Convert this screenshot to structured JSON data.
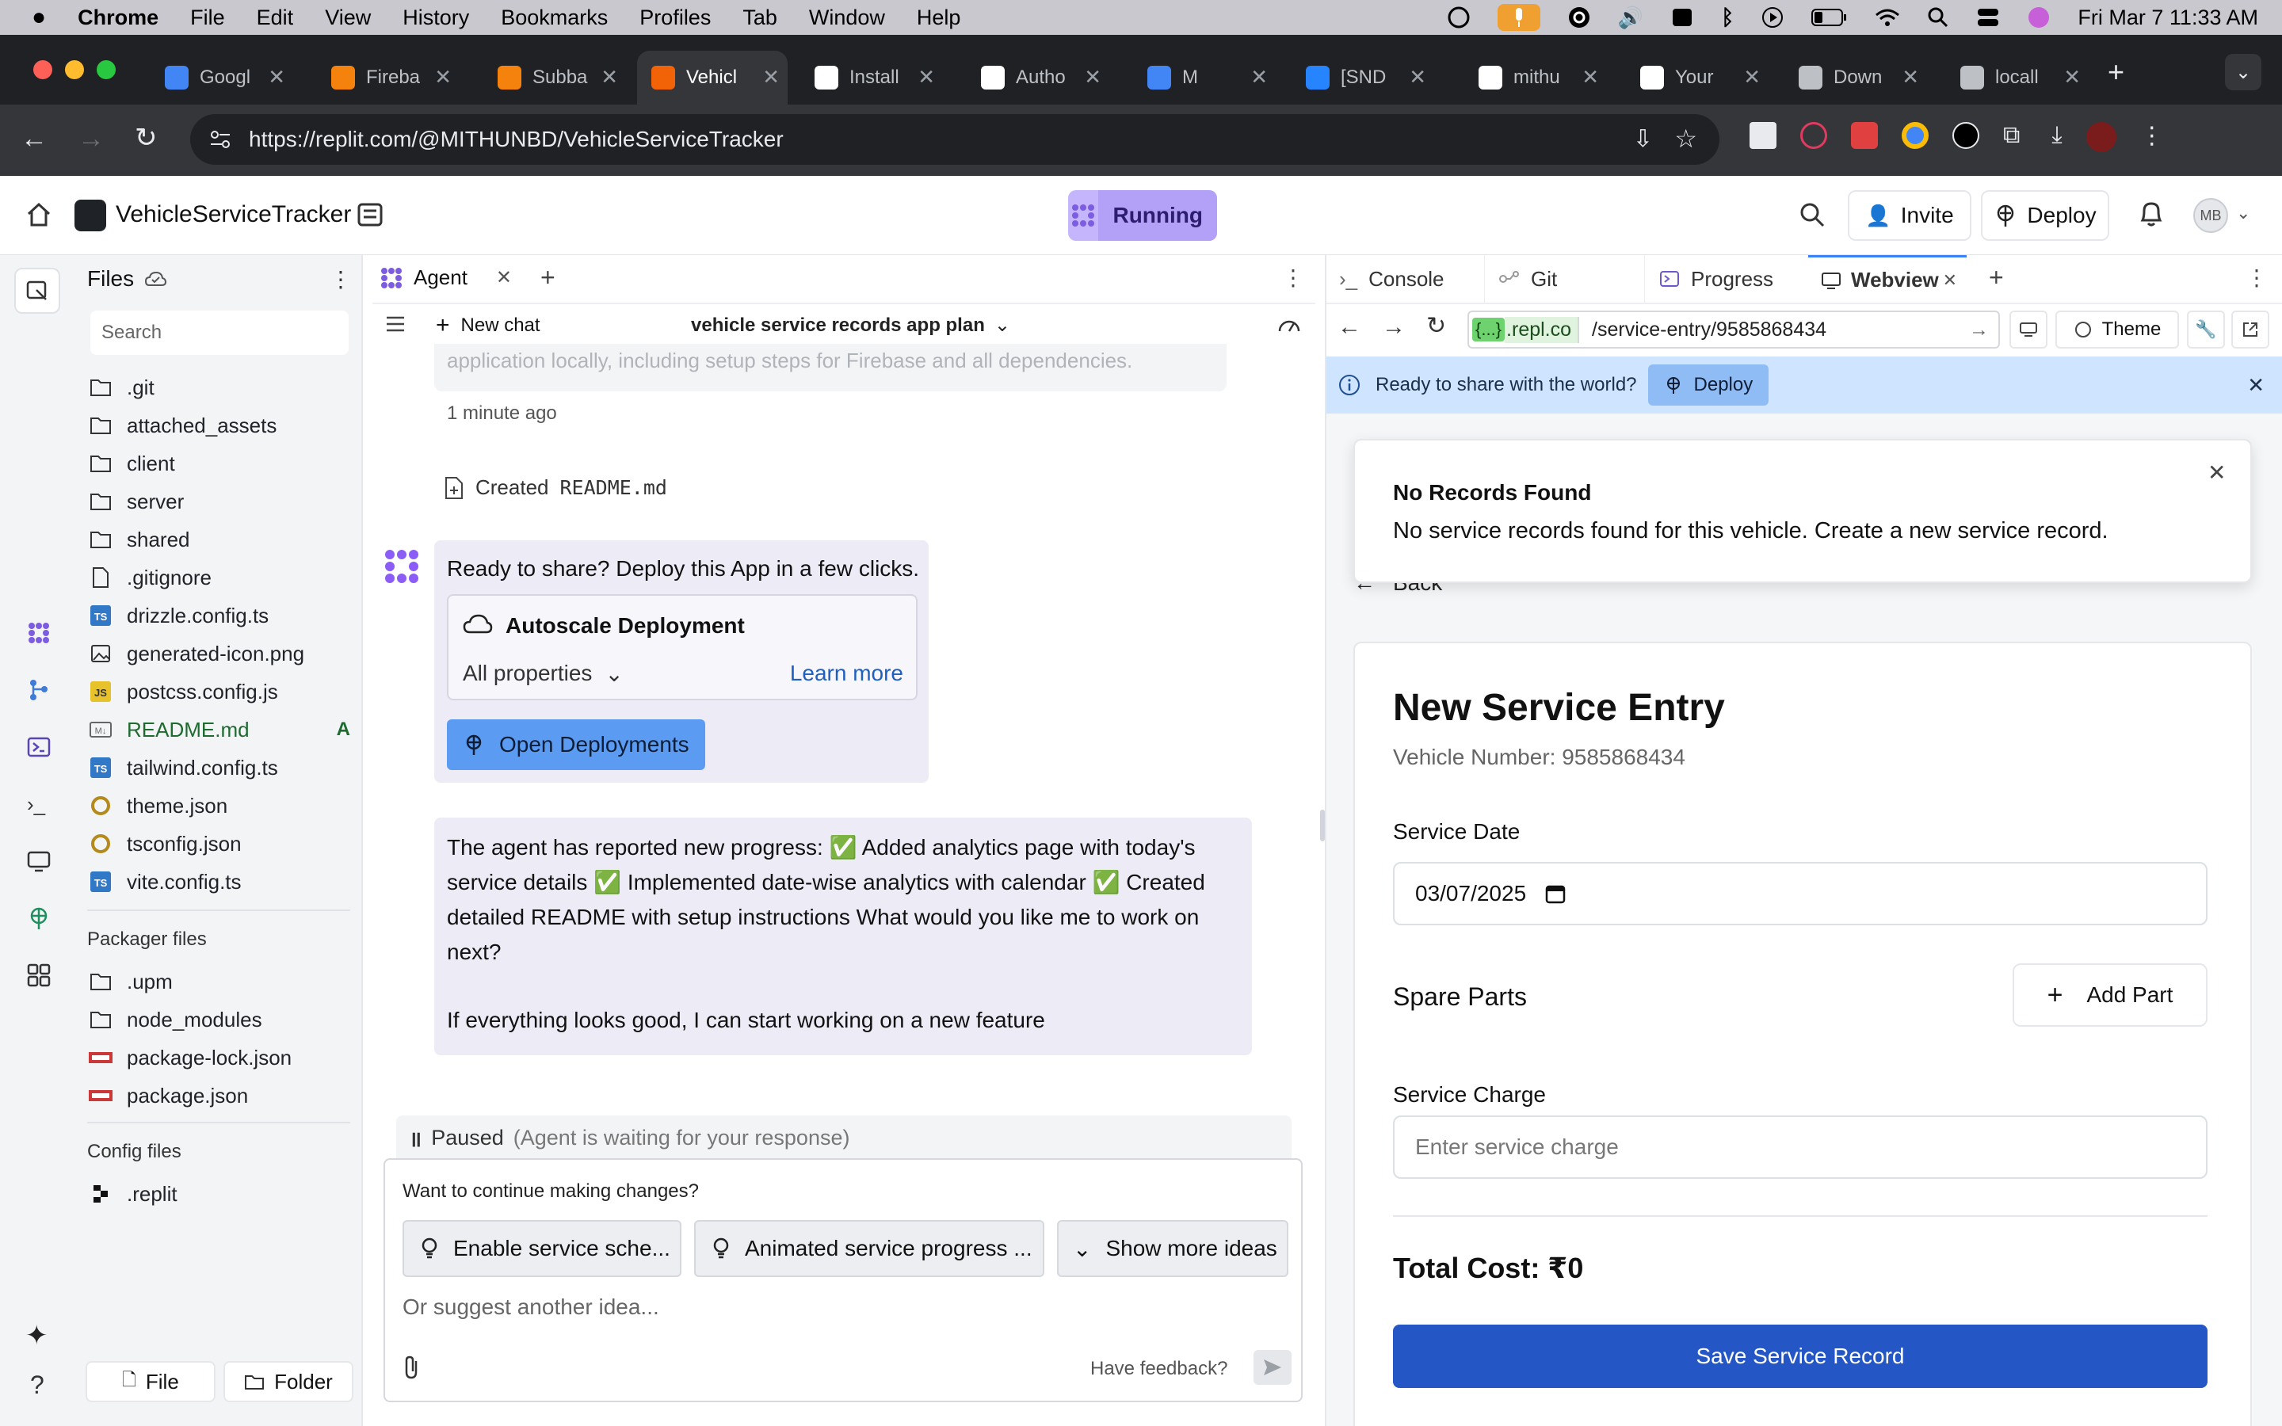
{
  "menubar": {
    "app": "Chrome",
    "items": [
      "File",
      "Edit",
      "View",
      "History",
      "Bookmarks",
      "Profiles",
      "Tab",
      "Window",
      "Help"
    ],
    "datetime": "Fri Mar 7  11:33 AM"
  },
  "browser_tabs": [
    {
      "title": "Googl",
      "color": "#4285f4"
    },
    {
      "title": "Fireba",
      "color": "#f5820d"
    },
    {
      "title": "Subba",
      "color": "#f5820d"
    },
    {
      "title": "Vehicl",
      "color": "#f26207",
      "active": true
    },
    {
      "title": "Install",
      "color": "#ffffff"
    },
    {
      "title": "Autho",
      "color": "#ffffff"
    },
    {
      "title": "M",
      "color": "#4285f4"
    },
    {
      "title": "[SND",
      "color": "#2684ff"
    },
    {
      "title": "mithu",
      "color": "#ffffff"
    },
    {
      "title": "Your",
      "color": "#ffffff"
    },
    {
      "title": "Down",
      "color": "#bdc1c6"
    },
    {
      "title": "locall",
      "color": "#bdc1c6"
    }
  ],
  "url": "https://replit.com/@MITHUNBD/VehicleServiceTracker",
  "replit": {
    "project_name": "VehicleServiceTracker",
    "status": "Running",
    "invite_label": "Invite",
    "deploy_label": "Deploy",
    "avatar": "MB"
  },
  "files": {
    "title": "Files",
    "search_placeholder": "Search",
    "items": [
      {
        "name": ".git",
        "type": "folder"
      },
      {
        "name": "attached_assets",
        "type": "folder"
      },
      {
        "name": "client",
        "type": "folder"
      },
      {
        "name": "server",
        "type": "folder"
      },
      {
        "name": "shared",
        "type": "folder"
      },
      {
        "name": ".gitignore",
        "type": "file"
      },
      {
        "name": "drizzle.config.ts",
        "type": "ts"
      },
      {
        "name": "generated-icon.png",
        "type": "image"
      },
      {
        "name": "postcss.config.js",
        "type": "js"
      },
      {
        "name": "README.md",
        "type": "md",
        "badge": "A"
      },
      {
        "name": "tailwind.config.ts",
        "type": "ts"
      },
      {
        "name": "theme.json",
        "type": "json"
      },
      {
        "name": "tsconfig.json",
        "type": "json"
      },
      {
        "name": "vite.config.ts",
        "type": "ts"
      }
    ],
    "packager_title": "Packager files",
    "packager_items": [
      {
        "name": ".upm",
        "type": "folder"
      },
      {
        "name": "node_modules",
        "type": "folder"
      },
      {
        "name": "package-lock.json",
        "type": "npm"
      },
      {
        "name": "package.json",
        "type": "npm"
      }
    ],
    "config_title": "Config files",
    "config_items": [
      {
        "name": ".replit",
        "type": "replit"
      }
    ],
    "file_button": "File",
    "folder_button": "Folder"
  },
  "agent": {
    "tab_label": "Agent",
    "new_chat": "New chat",
    "plan_title": "vehicle service records app plan",
    "faded_text": "application locally, including setup steps for Firebase and all dependencies.",
    "timestamp": "1 minute ago",
    "created_prefix": "Created",
    "created_file": "README.md",
    "deploy_prompt": "Ready to share? Deploy this App in a few clicks.",
    "autoscale_title": "Autoscale Deployment",
    "all_properties": "All properties",
    "learn_more": "Learn more",
    "open_deployments": "Open Deployments",
    "progress_message": "The agent has reported new progress: ✅ Added analytics page with today's service details ✅ Implemented date-wise analytics with calendar ✅ Created detailed README with setup instructions What would you like me to work on next?",
    "followup": "If everything looks good, I can start working on a new feature",
    "paused_label": "Paused",
    "paused_detail": "(Agent is waiting for your response)",
    "continue_prompt": "Want to continue making changes?",
    "suggestions": [
      "Enable service sche...",
      "Animated service progress ..."
    ],
    "show_more": "Show more ideas",
    "input_placeholder": "Or suggest another idea...",
    "feedback": "Have feedback?"
  },
  "right_panel": {
    "tabs": [
      "Console",
      "Git",
      "Progress",
      "Webview"
    ],
    "active_tab": "Webview",
    "domain_prefix": "{...}",
    "domain": ".repl.co",
    "path": "/service-entry/9585868434",
    "theme_label": "Theme",
    "banner_text": "Ready to share with the world?",
    "banner_deploy": "Deploy"
  },
  "webview": {
    "toast_title": "No Records Found",
    "toast_body": "No service records found for this vehicle. Create a new service record.",
    "back_label": "Back",
    "form_title": "New Service Entry",
    "vehicle_number": "Vehicle Number: 9585868434",
    "service_date_label": "Service Date",
    "service_date_value": "03/07/2025",
    "spare_parts_label": "Spare Parts",
    "add_part": "Add Part",
    "service_charge_label": "Service Charge",
    "service_charge_placeholder": "Enter service charge",
    "total_cost": "Total Cost: ₹0",
    "save_button": "Save Service Record"
  },
  "colors": {
    "accent_purple": "#8b5cf6",
    "running_bg": "#c4b5fd",
    "banner_bg": "#cfe4ff",
    "save_blue": "#2457c5",
    "agent_bubble": "#ecebf6"
  }
}
